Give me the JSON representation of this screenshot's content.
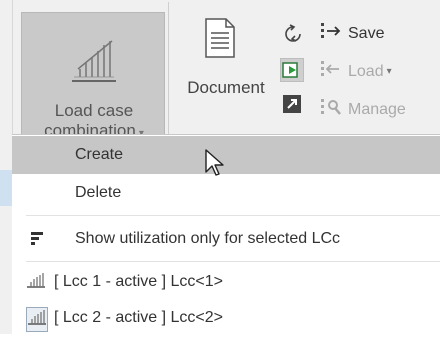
{
  "ribbon": {
    "load_case_combination": {
      "label_line1": "Load case",
      "label_line2": "combination",
      "icon": "load-case-combination-icon"
    },
    "document": {
      "label": "Document",
      "icon": "document-icon"
    },
    "save": {
      "label": "Save",
      "icon": "save-icon"
    },
    "load": {
      "label": "Load",
      "icon": "load-icon"
    },
    "manage": {
      "label": "Manage",
      "icon": "manage-icon"
    }
  },
  "menu": {
    "create": "Create",
    "delete": "Delete",
    "show_utilization": "Show utilization only for selected LCc",
    "lcc_items": [
      {
        "label": "[ Lcc 1 - active ] Lcc<1>",
        "icon": "load-case-icon"
      },
      {
        "label": "[ Lcc 2 - active ] Lcc<2>",
        "icon": "load-case-icon"
      }
    ]
  },
  "colors": {
    "ribbon_bg": "#f0f0f0",
    "hover_bg": "#c6c6c6",
    "disabled_text": "#aaaaaa"
  }
}
